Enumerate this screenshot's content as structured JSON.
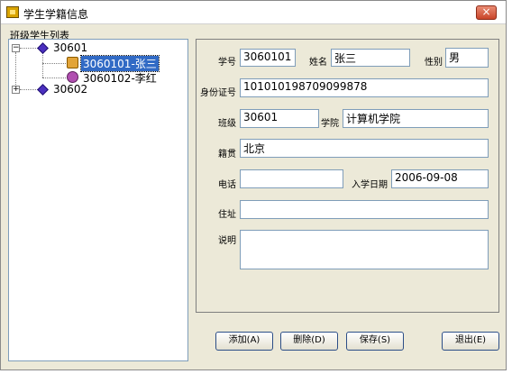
{
  "window": {
    "title": "学生学籍信息",
    "close_label": "×"
  },
  "tree": {
    "caption": "班级学生列表",
    "classes": [
      {
        "name": "30601",
        "expander": "−"
      },
      {
        "name": "30602",
        "expander": "+"
      }
    ],
    "students": [
      {
        "label": "3060101-张三"
      },
      {
        "label": "3060102-李红"
      }
    ]
  },
  "form": {
    "student_id": {
      "label": "学号",
      "value": "3060101"
    },
    "name": {
      "label": "姓名",
      "value": "张三"
    },
    "gender": {
      "label": "性别",
      "value": "男"
    },
    "id_number": {
      "label": "身份证号",
      "value": "101010198709099878"
    },
    "class": {
      "label": "班级",
      "value": "30601"
    },
    "college": {
      "label": "学院",
      "value": "计算机学院"
    },
    "native_place": {
      "label": "籍贯",
      "value": "北京"
    },
    "phone": {
      "label": "电话",
      "value": ""
    },
    "enroll_date": {
      "label": "入学日期",
      "value": "2006-09-08"
    },
    "address": {
      "label": "住址",
      "value": ""
    },
    "notes": {
      "label": "说明",
      "value": ""
    }
  },
  "buttons": {
    "add": "添加(A)",
    "delete": "删除(D)",
    "save": "保存(S)",
    "exit": "退出(E)"
  }
}
